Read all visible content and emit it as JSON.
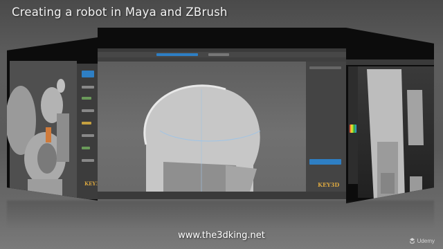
{
  "header": {
    "title": "Creating a robot in Maya and ZBrush"
  },
  "footer": {
    "url": "www.the3dking.net",
    "brand": "Udemy"
  },
  "watermark": {
    "left_logo": "KEY3D",
    "center_logo": "KEY3D"
  },
  "icons": [
    "udemy-logo-icon"
  ],
  "colors": {
    "background": "#595959",
    "panel": "#0c0c0c",
    "maya_viewport": "#6a6a6a",
    "accent_blue": "#2e7fc4",
    "logo_gold": "#d9a640"
  }
}
